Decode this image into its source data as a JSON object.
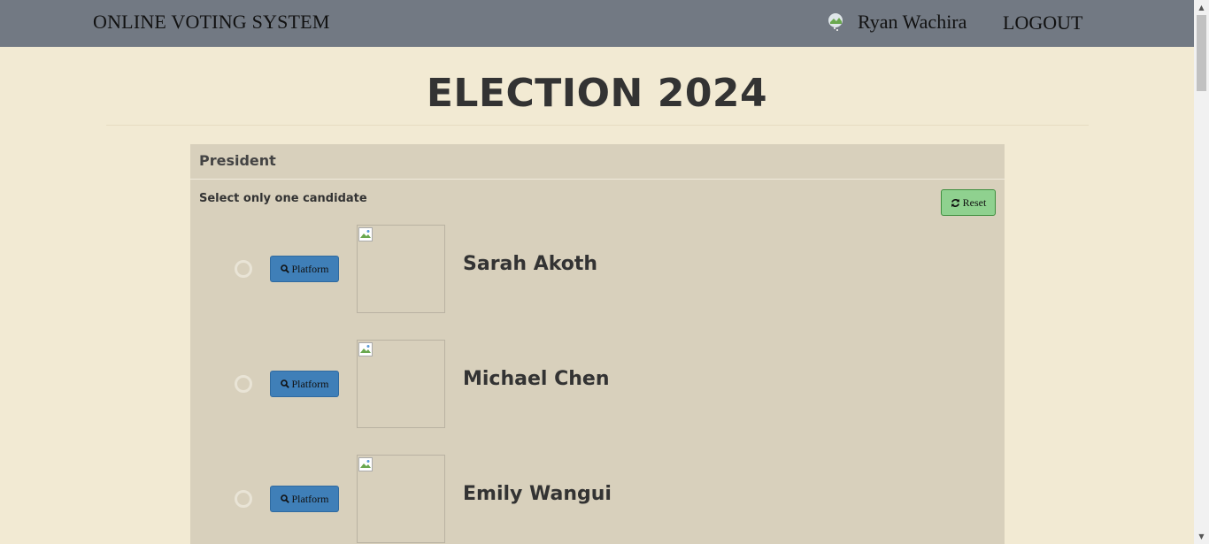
{
  "navbar": {
    "brand": "ONLINE VOTING SYSTEM",
    "user_name": "Ryan Wachira",
    "logout_label": "LOGOUT"
  },
  "page_title": "ELECTION 2024",
  "position": {
    "heading": "President",
    "instruction": "Select only one candidate",
    "reset_label": "Reset",
    "platform_label": "Platform",
    "candidates": [
      {
        "name": "Sarah Akoth"
      },
      {
        "name": "Michael Chen"
      },
      {
        "name": "Emily Wangui"
      }
    ]
  },
  "colors": {
    "navbar_bg": "#727983",
    "page_bg": "#f2ead3",
    "panel_bg": "#d8d0bc",
    "platform_button": "#3f7fb8",
    "reset_button": "#8fd18f"
  }
}
